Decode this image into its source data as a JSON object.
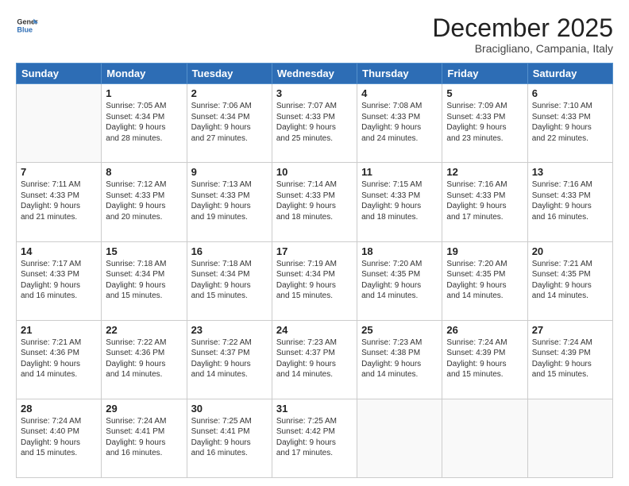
{
  "logo": {
    "line1": "General",
    "line2": "Blue"
  },
  "title": "December 2025",
  "location": "Bracigliano, Campania, Italy",
  "weekdays": [
    "Sunday",
    "Monday",
    "Tuesday",
    "Wednesday",
    "Thursday",
    "Friday",
    "Saturday"
  ],
  "weeks": [
    [
      {
        "day": "",
        "info": ""
      },
      {
        "day": "1",
        "info": "Sunrise: 7:05 AM\nSunset: 4:34 PM\nDaylight: 9 hours\nand 28 minutes."
      },
      {
        "day": "2",
        "info": "Sunrise: 7:06 AM\nSunset: 4:34 PM\nDaylight: 9 hours\nand 27 minutes."
      },
      {
        "day": "3",
        "info": "Sunrise: 7:07 AM\nSunset: 4:33 PM\nDaylight: 9 hours\nand 25 minutes."
      },
      {
        "day": "4",
        "info": "Sunrise: 7:08 AM\nSunset: 4:33 PM\nDaylight: 9 hours\nand 24 minutes."
      },
      {
        "day": "5",
        "info": "Sunrise: 7:09 AM\nSunset: 4:33 PM\nDaylight: 9 hours\nand 23 minutes."
      },
      {
        "day": "6",
        "info": "Sunrise: 7:10 AM\nSunset: 4:33 PM\nDaylight: 9 hours\nand 22 minutes."
      }
    ],
    [
      {
        "day": "7",
        "info": "Sunrise: 7:11 AM\nSunset: 4:33 PM\nDaylight: 9 hours\nand 21 minutes."
      },
      {
        "day": "8",
        "info": "Sunrise: 7:12 AM\nSunset: 4:33 PM\nDaylight: 9 hours\nand 20 minutes."
      },
      {
        "day": "9",
        "info": "Sunrise: 7:13 AM\nSunset: 4:33 PM\nDaylight: 9 hours\nand 19 minutes."
      },
      {
        "day": "10",
        "info": "Sunrise: 7:14 AM\nSunset: 4:33 PM\nDaylight: 9 hours\nand 18 minutes."
      },
      {
        "day": "11",
        "info": "Sunrise: 7:15 AM\nSunset: 4:33 PM\nDaylight: 9 hours\nand 18 minutes."
      },
      {
        "day": "12",
        "info": "Sunrise: 7:16 AM\nSunset: 4:33 PM\nDaylight: 9 hours\nand 17 minutes."
      },
      {
        "day": "13",
        "info": "Sunrise: 7:16 AM\nSunset: 4:33 PM\nDaylight: 9 hours\nand 16 minutes."
      }
    ],
    [
      {
        "day": "14",
        "info": "Sunrise: 7:17 AM\nSunset: 4:33 PM\nDaylight: 9 hours\nand 16 minutes."
      },
      {
        "day": "15",
        "info": "Sunrise: 7:18 AM\nSunset: 4:34 PM\nDaylight: 9 hours\nand 15 minutes."
      },
      {
        "day": "16",
        "info": "Sunrise: 7:18 AM\nSunset: 4:34 PM\nDaylight: 9 hours\nand 15 minutes."
      },
      {
        "day": "17",
        "info": "Sunrise: 7:19 AM\nSunset: 4:34 PM\nDaylight: 9 hours\nand 15 minutes."
      },
      {
        "day": "18",
        "info": "Sunrise: 7:20 AM\nSunset: 4:35 PM\nDaylight: 9 hours\nand 14 minutes."
      },
      {
        "day": "19",
        "info": "Sunrise: 7:20 AM\nSunset: 4:35 PM\nDaylight: 9 hours\nand 14 minutes."
      },
      {
        "day": "20",
        "info": "Sunrise: 7:21 AM\nSunset: 4:35 PM\nDaylight: 9 hours\nand 14 minutes."
      }
    ],
    [
      {
        "day": "21",
        "info": "Sunrise: 7:21 AM\nSunset: 4:36 PM\nDaylight: 9 hours\nand 14 minutes."
      },
      {
        "day": "22",
        "info": "Sunrise: 7:22 AM\nSunset: 4:36 PM\nDaylight: 9 hours\nand 14 minutes."
      },
      {
        "day": "23",
        "info": "Sunrise: 7:22 AM\nSunset: 4:37 PM\nDaylight: 9 hours\nand 14 minutes."
      },
      {
        "day": "24",
        "info": "Sunrise: 7:23 AM\nSunset: 4:37 PM\nDaylight: 9 hours\nand 14 minutes."
      },
      {
        "day": "25",
        "info": "Sunrise: 7:23 AM\nSunset: 4:38 PM\nDaylight: 9 hours\nand 14 minutes."
      },
      {
        "day": "26",
        "info": "Sunrise: 7:24 AM\nSunset: 4:39 PM\nDaylight: 9 hours\nand 15 minutes."
      },
      {
        "day": "27",
        "info": "Sunrise: 7:24 AM\nSunset: 4:39 PM\nDaylight: 9 hours\nand 15 minutes."
      }
    ],
    [
      {
        "day": "28",
        "info": "Sunrise: 7:24 AM\nSunset: 4:40 PM\nDaylight: 9 hours\nand 15 minutes."
      },
      {
        "day": "29",
        "info": "Sunrise: 7:24 AM\nSunset: 4:41 PM\nDaylight: 9 hours\nand 16 minutes."
      },
      {
        "day": "30",
        "info": "Sunrise: 7:25 AM\nSunset: 4:41 PM\nDaylight: 9 hours\nand 16 minutes."
      },
      {
        "day": "31",
        "info": "Sunrise: 7:25 AM\nSunset: 4:42 PM\nDaylight: 9 hours\nand 17 minutes."
      },
      {
        "day": "",
        "info": ""
      },
      {
        "day": "",
        "info": ""
      },
      {
        "day": "",
        "info": ""
      }
    ]
  ]
}
